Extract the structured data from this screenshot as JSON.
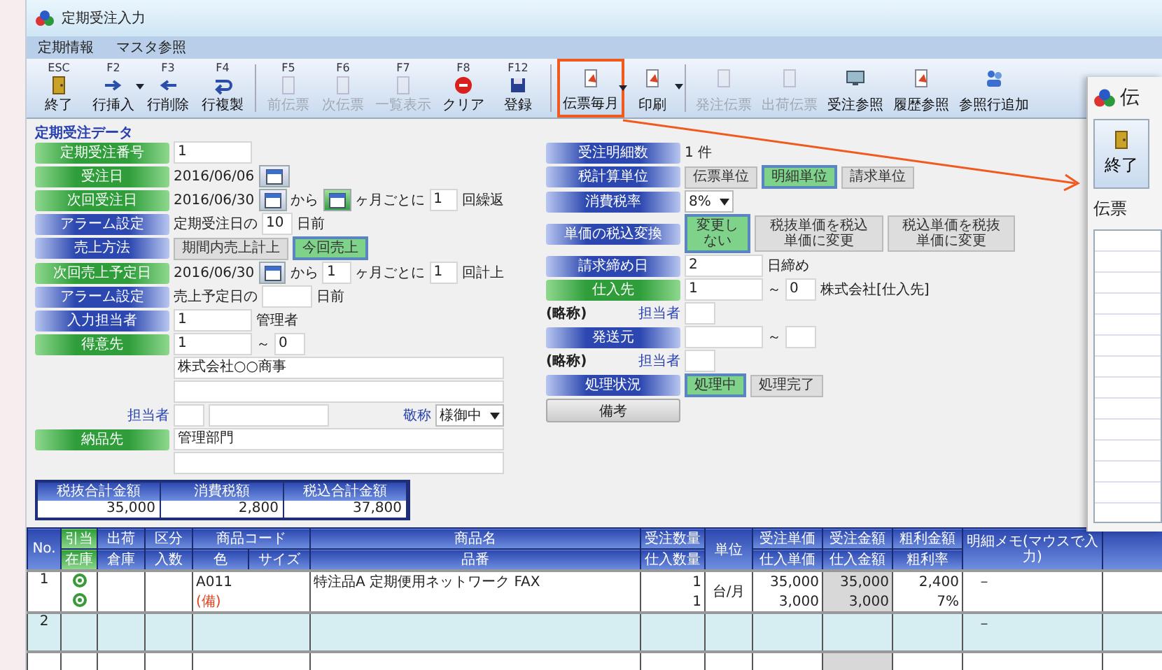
{
  "window": {
    "title": "定期受注入力"
  },
  "menu": [
    "定期情報",
    "マスタ参照"
  ],
  "toolbar": [
    {
      "key": "ESC",
      "kind": "exit",
      "label": "終了",
      "disabled": false,
      "dropdown": false,
      "highlighted": false
    },
    {
      "key": "F2",
      "kind": "insert",
      "label": "行挿入",
      "disabled": false,
      "dropdown": true,
      "highlighted": false
    },
    {
      "key": "F3",
      "kind": "delete",
      "label": "行削除",
      "disabled": false,
      "dropdown": false,
      "highlighted": false
    },
    {
      "key": "F4",
      "kind": "copy",
      "label": "行複製",
      "disabled": false,
      "dropdown": false,
      "highlighted": false
    },
    {
      "key": "F5",
      "kind": "page",
      "label": "前伝票",
      "disabled": true,
      "dropdown": false,
      "highlighted": false
    },
    {
      "key": "F6",
      "kind": "page",
      "label": "次伝票",
      "disabled": true,
      "dropdown": false,
      "highlighted": false
    },
    {
      "key": "F7",
      "kind": "page",
      "label": "一覧表示",
      "disabled": true,
      "dropdown": false,
      "highlighted": false
    },
    {
      "key": "F8",
      "kind": "clear",
      "label": "クリア",
      "disabled": false,
      "dropdown": false,
      "highlighted": false
    },
    {
      "key": "F12",
      "kind": "save",
      "label": "登録",
      "disabled": false,
      "dropdown": false,
      "highlighted": false
    },
    {
      "kind": "slip",
      "label": "伝票毎月",
      "disabled": false,
      "dropdown": true,
      "highlighted": true
    },
    {
      "kind": "slip",
      "label": "印刷",
      "disabled": false,
      "dropdown": true,
      "highlighted": false
    },
    {
      "kind": "page",
      "label": "発注伝票",
      "disabled": true,
      "dropdown": false,
      "highlighted": false
    },
    {
      "kind": "page",
      "label": "出荷伝票",
      "disabled": true,
      "dropdown": false,
      "highlighted": false
    },
    {
      "kind": "monitor",
      "label": "受注参照",
      "disabled": false,
      "dropdown": false,
      "highlighted": false
    },
    {
      "kind": "slip",
      "label": "履歴参照",
      "disabled": false,
      "dropdown": false,
      "highlighted": false
    },
    {
      "kind": "people",
      "label": "参照行追加",
      "disabled": false,
      "dropdown": false,
      "highlighted": false
    }
  ],
  "section_title": "定期受注データ",
  "form_left": [
    {
      "label": "定期受注番号",
      "kind": "required",
      "parts": [
        {
          "kind": "field",
          "value": "1"
        }
      ]
    },
    {
      "label": "受注日",
      "kind": "required",
      "parts": [
        {
          "kind": "text",
          "text": "2016/06/06"
        },
        {
          "kind": "calendar",
          "active": false
        }
      ]
    },
    {
      "label": "次回受注日",
      "kind": "required",
      "parts": [
        {
          "kind": "text",
          "text": "2016/06/30"
        },
        {
          "kind": "calendar",
          "active": false
        },
        {
          "kind": "text",
          "text": "から"
        },
        {
          "kind": "calendar",
          "active": true
        },
        {
          "kind": "text",
          "text": "ヶ月ごとに"
        },
        {
          "kind": "short_field",
          "value": "1"
        },
        {
          "kind": "text",
          "text": "回繰返"
        }
      ]
    },
    {
      "label": "アラーム設定",
      "kind": "optional",
      "parts": [
        {
          "kind": "text",
          "text": "定期受注日の"
        },
        {
          "kind": "short_field",
          "value": "10"
        },
        {
          "kind": "text",
          "text": "日前"
        }
      ]
    },
    {
      "label": "売上方法",
      "kind": "optional",
      "parts": [
        {
          "kind": "choice",
          "label": "期間内売上計上",
          "selected": false
        },
        {
          "kind": "choice",
          "label": "今回売上",
          "selected": true
        }
      ]
    },
    {
      "label": "次回売上予定日",
      "kind": "required",
      "parts": [
        {
          "kind": "text",
          "text": "2016/06/30"
        },
        {
          "kind": "calendar",
          "active": false
        },
        {
          "kind": "text",
          "text": "から"
        },
        {
          "kind": "short_field",
          "value": "1"
        },
        {
          "kind": "text",
          "text": "ヶ月ごとに"
        },
        {
          "kind": "short_field",
          "value": "1"
        },
        {
          "kind": "text",
          "text": "回計上"
        }
      ]
    },
    {
      "label": "アラーム設定",
      "kind": "optional",
      "parts": [
        {
          "kind": "text",
          "text": "売上予定日の"
        },
        {
          "kind": "small_field"
        },
        {
          "kind": "text",
          "text": "日前"
        }
      ]
    },
    {
      "label": "入力担当者",
      "kind": "optional",
      "parts": [
        {
          "kind": "field",
          "value": "1"
        },
        {
          "kind": "text",
          "text": "管理者"
        }
      ]
    },
    {
      "label": "得意先",
      "kind": "required",
      "parts": [
        {
          "kind": "field",
          "value": "1"
        },
        {
          "kind": "text",
          "text": "～"
        },
        {
          "kind": "short_field",
          "value": "0"
        }
      ]
    },
    {
      "parts": [
        {
          "kind": "wide_field",
          "value": "株式会社○○商事"
        }
      ]
    },
    {
      "parts": [
        {
          "kind": "wide_field"
        }
      ]
    },
    {
      "sub": "担当者",
      "parts": [
        {
          "kind": "short_field"
        },
        {
          "kind": "long_field"
        },
        {
          "kind": "link",
          "text": "敬称"
        },
        {
          "kind": "select",
          "value": "様御中"
        }
      ]
    },
    {
      "label": "納品先",
      "kind": "required",
      "parts": [
        {
          "kind": "wide_field",
          "value": "管理部門"
        }
      ]
    },
    {
      "parts": [
        {
          "kind": "wide_field"
        }
      ]
    }
  ],
  "form_right": [
    {
      "label": "受注明細数",
      "kind": "optional",
      "parts": [
        {
          "kind": "text",
          "text": "1 件"
        }
      ]
    },
    {
      "label": "税計算単位",
      "kind": "optional",
      "parts": [
        {
          "kind": "choice",
          "label": "伝票単位",
          "selected": false
        },
        {
          "kind": "choice",
          "label": "明細単位",
          "selected": true
        },
        {
          "kind": "choice",
          "label": "請求単位",
          "selected": false
        }
      ]
    },
    {
      "label": "消費税率",
      "kind": "optional",
      "parts": [
        {
          "kind": "select",
          "value": "8%"
        }
      ]
    },
    {
      "label": "単価の税込変換",
      "kind": "optional",
      "parts": [
        {
          "kind": "choice",
          "label": "変更しない",
          "selected": true
        },
        {
          "kind": "choice",
          "label": "税抜単価を税込単価に変更",
          "selected": false
        },
        {
          "kind": "choice",
          "label": "税込単価を税抜単価に変更",
          "selected": false
        }
      ]
    },
    {
      "label": "請求締め日",
      "kind": "optional",
      "parts": [
        {
          "kind": "field",
          "value": "2"
        },
        {
          "kind": "text",
          "text": "日締め"
        }
      ]
    },
    {
      "label": "仕入先",
      "kind": "required",
      "parts": [
        {
          "kind": "field",
          "value": "1"
        },
        {
          "kind": "text",
          "text": "～"
        },
        {
          "kind": "short_field",
          "value": "0"
        },
        {
          "kind": "text",
          "text": "株式会社[仕入先]"
        }
      ]
    },
    {
      "note": "(略称)",
      "sub": "担当者",
      "parts": [
        {
          "kind": "short_field"
        }
      ]
    },
    {
      "label": "発送元",
      "kind": "optional",
      "parts": [
        {
          "kind": "field"
        },
        {
          "kind": "text",
          "text": "～"
        },
        {
          "kind": "short_field"
        }
      ]
    },
    {
      "note": "(略称)",
      "sub": "担当者",
      "parts": [
        {
          "kind": "short_field"
        }
      ]
    },
    {
      "label": "処理状況",
      "kind": "optional",
      "parts": [
        {
          "kind": "choice",
          "label": "処理中",
          "selected": true
        },
        {
          "kind": "choice",
          "label": "処理完了",
          "selected": false
        }
      ]
    },
    {
      "label": "備考",
      "kind": "button"
    }
  ],
  "summary": [
    {
      "label": "税抜合計金額",
      "value": "35,000"
    },
    {
      "label": "消費税額",
      "value": "2,800"
    },
    {
      "label": "税込合計金額",
      "value": "37,800"
    }
  ],
  "table": {
    "columns_top": [
      {
        "label": "No.",
        "green": false
      },
      {
        "label": "引当",
        "green": true
      },
      {
        "label": "出荷",
        "green": false
      },
      {
        "label": "区分",
        "green": false
      },
      {
        "label": "商品コード",
        "green": false
      },
      {
        "label": "商品名",
        "green": false
      },
      {
        "label": "受注数量",
        "green": false
      },
      {
        "label": "単位",
        "green": false
      },
      {
        "label": "受注単価",
        "green": false
      },
      {
        "label": "受注金額",
        "green": false
      },
      {
        "label": "粗利金額",
        "green": false
      },
      {
        "label": "明細メモ(マウスで入力)",
        "green": false
      }
    ],
    "columns_bottom": [
      {
        "label": "在庫",
        "green": true
      },
      {
        "label": "倉庫",
        "green": false
      },
      {
        "label": "入数",
        "green": false
      },
      {
        "label": "色",
        "green": false
      },
      {
        "label": "サイズ",
        "green": false
      },
      {
        "label": "品番",
        "green": false
      },
      {
        "label": "仕入数量",
        "green": false
      },
      {
        "label": "仕入単価",
        "green": false
      },
      {
        "label": "仕入金額",
        "green": false
      },
      {
        "label": "粗利率",
        "green": false
      }
    ],
    "rows": [
      {
        "no": "1",
        "shaded": false,
        "unit": "台/月",
        "memo": "－",
        "lines": [
          {
            "icon": true,
            "code": "A011",
            "kind": "plain",
            "name": "特注品A 定期便用ネットワーク FAX",
            "qty": "1",
            "price": "35,000",
            "amount": "35,000",
            "profit": "2,400"
          },
          {
            "icon": true,
            "code": "(備)",
            "kind": "note",
            "qty": "1",
            "price": "3,000",
            "amount": "3,000",
            "profit": "7%"
          }
        ]
      },
      {
        "no": "2",
        "shaded": true,
        "memo": "－",
        "lines": [
          {
            "icon": false
          },
          {
            "icon": false
          }
        ]
      }
    ]
  },
  "inset": {
    "title": "伝",
    "button": "終了",
    "label": "伝票"
  }
}
